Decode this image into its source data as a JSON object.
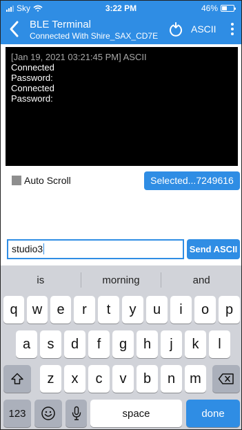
{
  "status_bar": {
    "carrier": "Sky",
    "time": "3:22 PM",
    "battery": "46%",
    "battery_level": 0.46
  },
  "nav": {
    "title": "BLE Terminal",
    "subtitle": "Connected With Shire_SAX_CD7E",
    "mode_label": "ASCII"
  },
  "terminal": {
    "lines": [
      "[Jan 19, 2021 03:21:45 PM] ASCII",
      "Connected",
      "Password:",
      "Connected",
      "Password:"
    ]
  },
  "controls": {
    "auto_scroll_label": "Auto Scroll",
    "device_button_label": "Selected...7249616"
  },
  "input": {
    "value": "studio3",
    "send_label": "Send ASCII"
  },
  "keyboard": {
    "suggestions": [
      "is",
      "morning",
      "and"
    ],
    "row1": [
      "q",
      "w",
      "e",
      "r",
      "t",
      "y",
      "u",
      "i",
      "o",
      "p"
    ],
    "row2": [
      "a",
      "s",
      "d",
      "f",
      "g",
      "h",
      "j",
      "k",
      "l"
    ],
    "row3": [
      "z",
      "x",
      "c",
      "v",
      "b",
      "n",
      "m"
    ],
    "numbers_label": "123",
    "space_label": "space",
    "done_label": "done"
  },
  "colors": {
    "accent": "#2f8de4",
    "keyboard_bg": "#d1d3d9",
    "terminal_bg": "#000000"
  },
  "icons": [
    "wifi-icon",
    "back-icon",
    "refresh-icon",
    "more-icon",
    "shift-icon",
    "backspace-icon",
    "emoji-icon",
    "microphone-icon"
  ]
}
